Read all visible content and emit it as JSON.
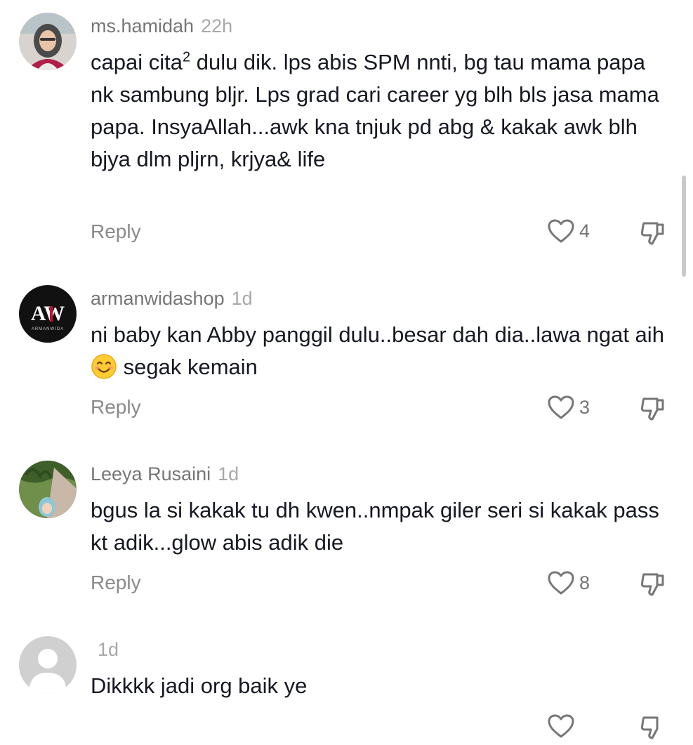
{
  "comments": [
    {
      "username": "ms.hamidah",
      "time": "22h",
      "text_before_sup": "capai cita",
      "sup": "2",
      "text_after_sup": " dulu dik. lps abis SPM nnti, bg tau mama papa nk sambung bljr. Lps grad cari career yg blh bls jasa mama papa. InsyaAllah...awk kna tnjuk pd abg & kakak awk blh bjya dlm pljrn, krjya& life",
      "reply_label": "Reply",
      "likes": "4"
    },
    {
      "username": "armanwidashop",
      "time": "1d",
      "text_before_emoji": "ni baby kan Abby panggil dulu..besar dah dia..lawa ngat aih ",
      "emoji_name": "smiling-face-emoji",
      "text_after_emoji": " segak kemain",
      "reply_label": "Reply",
      "likes": "3",
      "avatar_logo_text": "AW",
      "avatar_logo_sub": "ARMANWIDA"
    },
    {
      "username": "Leeya Rusaini",
      "time": "1d",
      "text": "bgus la si kakak tu dh kwen..nmpak giler seri si kakak pass kt adik...glow abis adik die",
      "reply_label": "Reply",
      "likes": "8"
    },
    {
      "username": "",
      "time": "1d",
      "text": "Dikkkk jadi org baik ye"
    }
  ],
  "icons": {
    "like": "heart-outline-icon",
    "dislike": "thumbs-down-icon"
  },
  "colors": {
    "primary_text": "#161823",
    "secondary_text": "#767676",
    "muted_text": "#a8a8a8"
  }
}
